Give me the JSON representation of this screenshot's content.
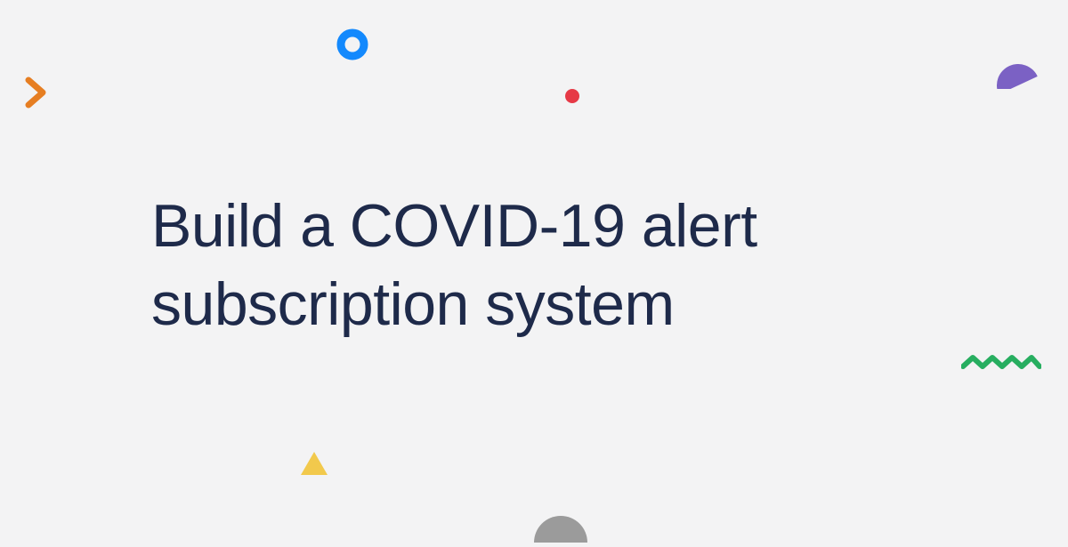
{
  "title": "Build a COVID-19 alert subscription system",
  "colors": {
    "background": "#f3f3f4",
    "text": "#1e2a4a",
    "orange": "#e67e22",
    "blue": "#1389fd",
    "red": "#e63946",
    "purple": "#7b61c4",
    "green": "#27ae60",
    "yellow": "#f2c94c",
    "gray": "#9b9b9b"
  }
}
